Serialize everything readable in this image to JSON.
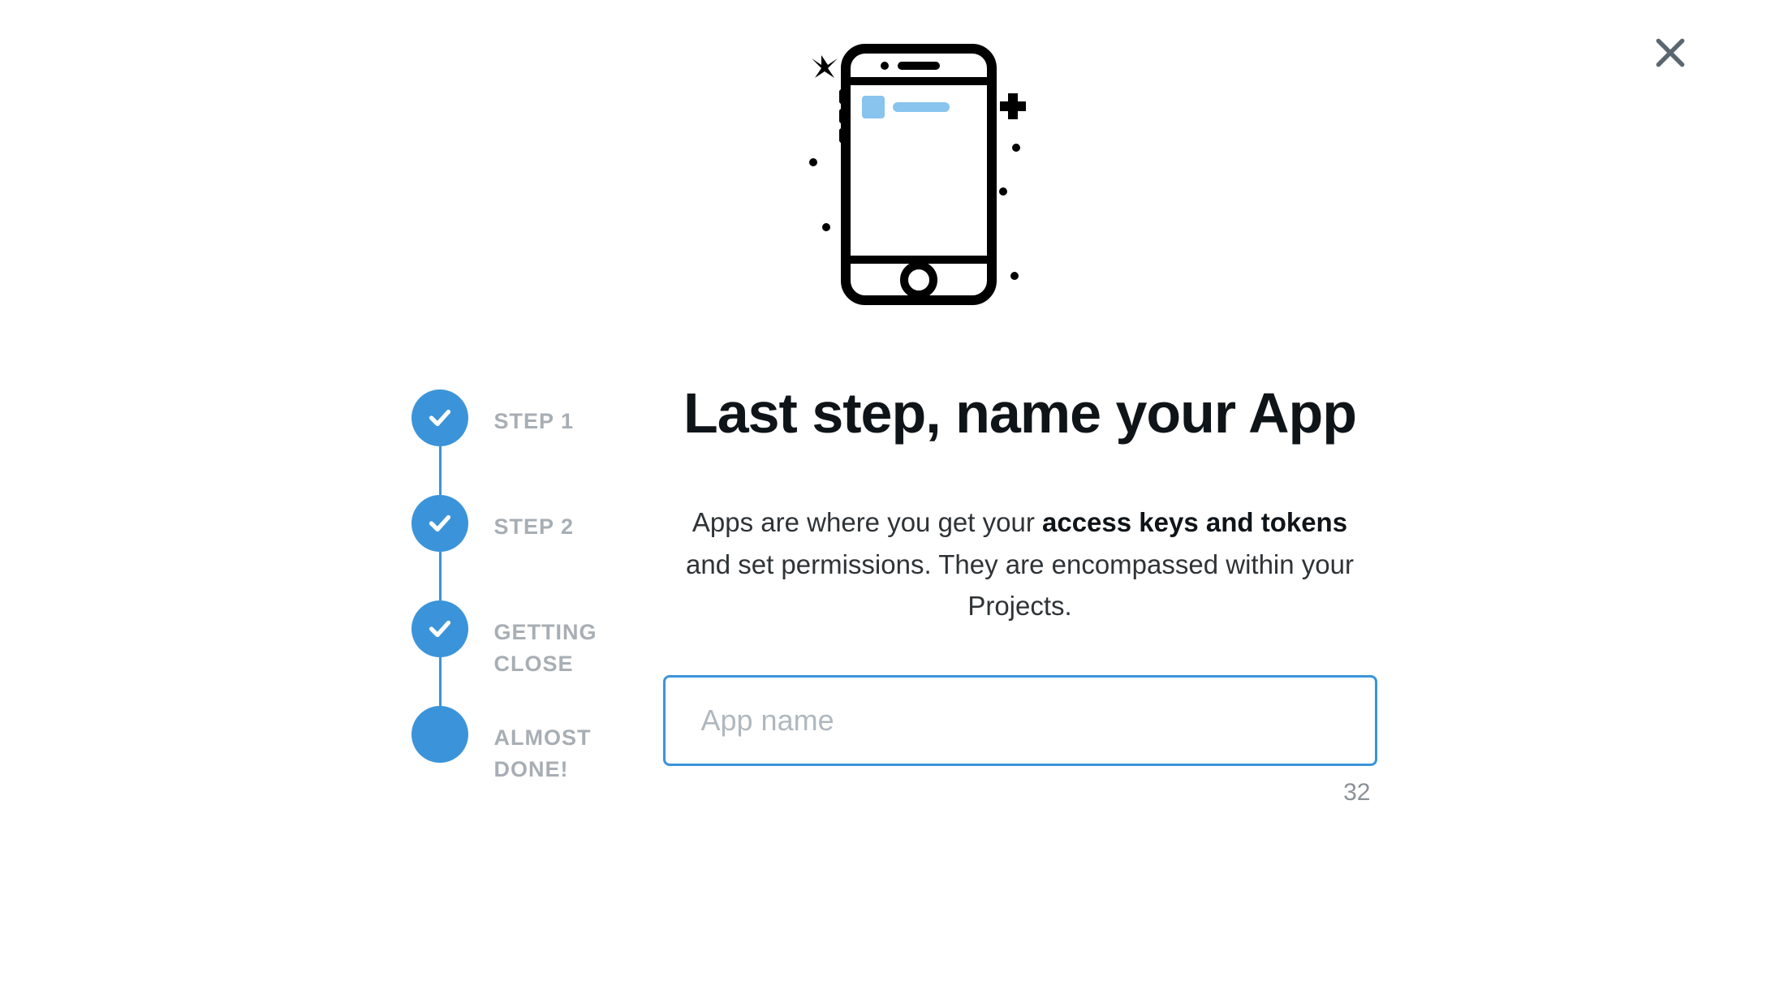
{
  "close": {
    "label": "Close"
  },
  "stepper": {
    "items": [
      {
        "label": "STEP 1",
        "done": true
      },
      {
        "label": "STEP 2",
        "done": true
      },
      {
        "label": "GETTING CLOSE",
        "done": true
      },
      {
        "label": "ALMOST DONE!",
        "done": false,
        "current": true
      }
    ]
  },
  "main": {
    "heading": "Last step, name your App",
    "description_pre": "Apps are where you get your ",
    "description_bold": "access keys and tokens",
    "description_post": " and set permissions. They are encompassed within your Projects.",
    "input": {
      "placeholder": "App name",
      "value": "",
      "char_count": "32"
    }
  }
}
